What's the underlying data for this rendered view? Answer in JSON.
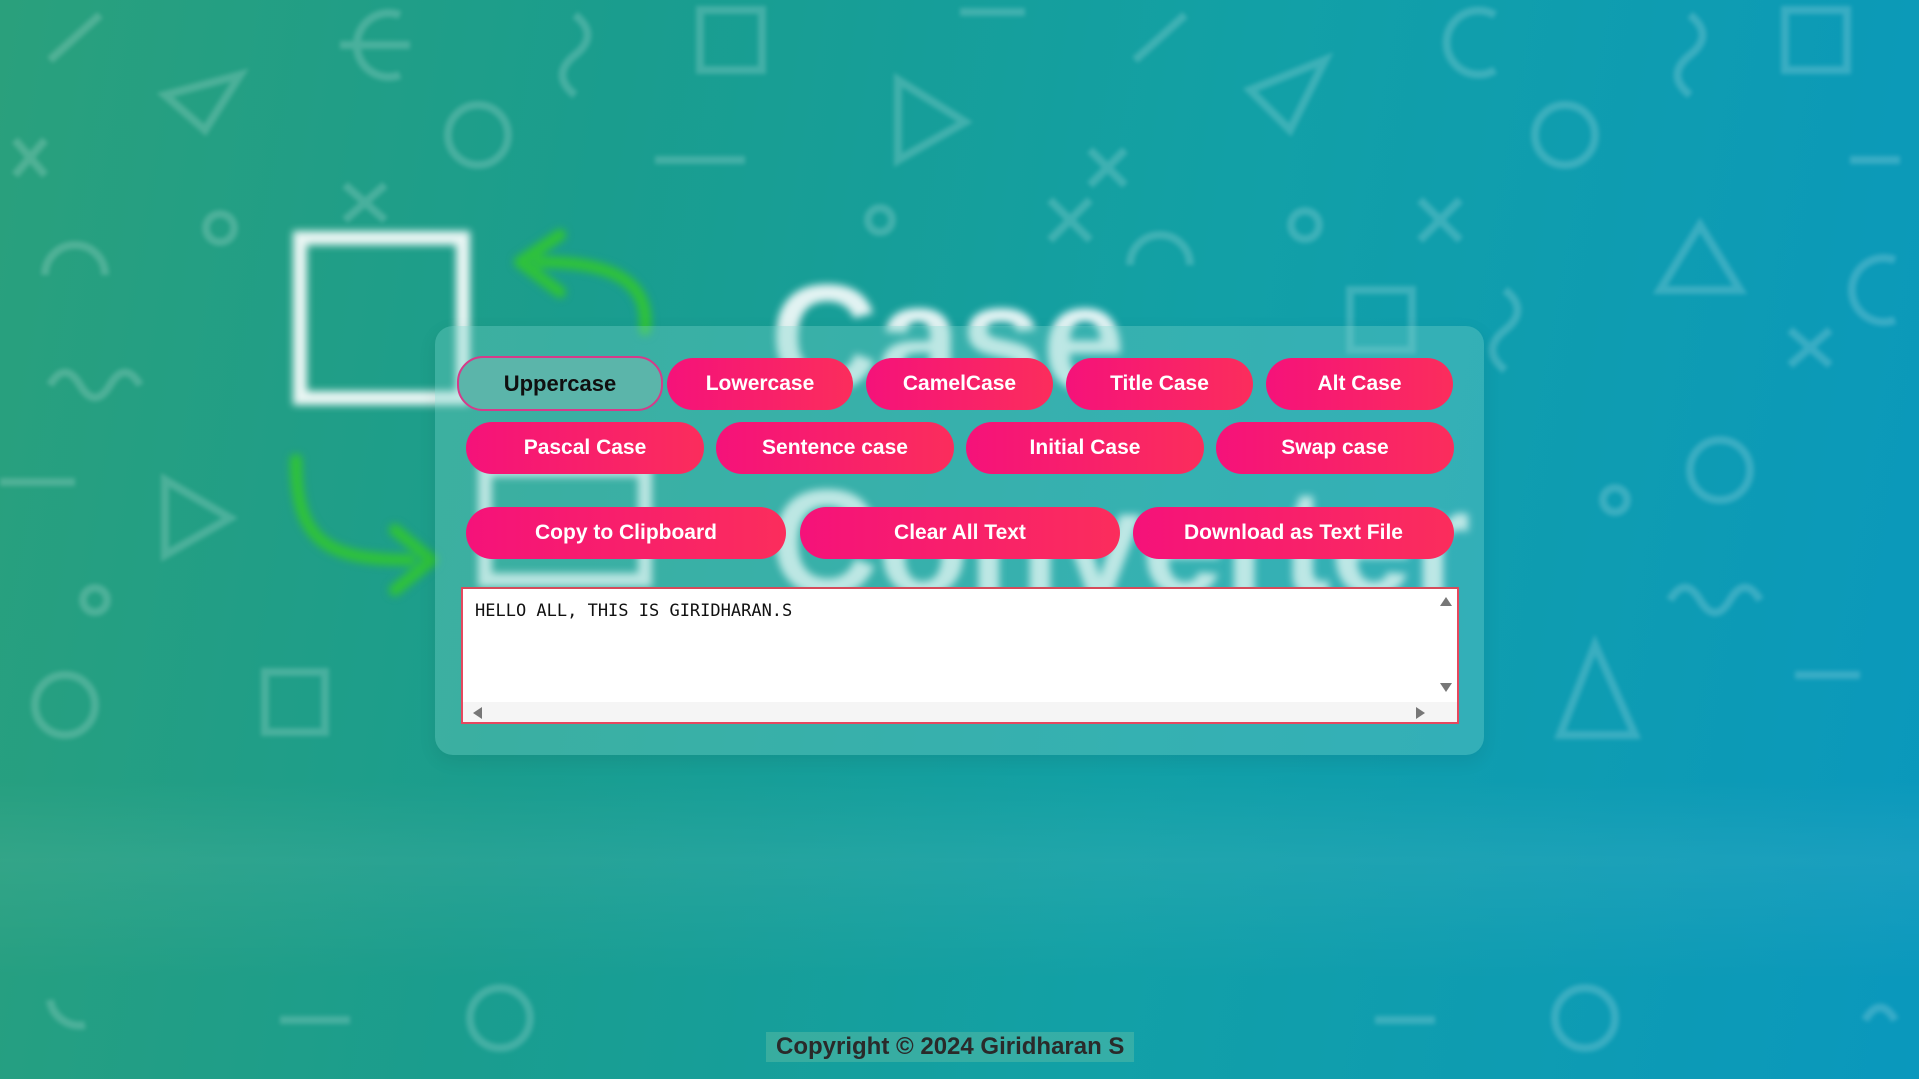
{
  "app": {
    "title_part1": "Case",
    "title_part2": "Converter"
  },
  "case_buttons": [
    {
      "label": "Uppercase",
      "active": true
    },
    {
      "label": "Lowercase"
    },
    {
      "label": "CamelCase"
    },
    {
      "label": "Title Case"
    },
    {
      "label": "Alt Case"
    },
    {
      "label": "Pascal Case"
    },
    {
      "label": "Sentence case"
    },
    {
      "label": "Initial Case"
    },
    {
      "label": "Swap case"
    }
  ],
  "actions": {
    "copy_label": "Copy to Clipboard",
    "clear_label": "Clear All Text",
    "download_label": "Download as Text File"
  },
  "editor": {
    "value": "HELLO ALL, THIS IS GIRIDHARAN.S"
  },
  "footer": {
    "text": "Copyright © 2024 Giridharan S"
  },
  "colors": {
    "button_gradient_start": "#f5127a",
    "button_gradient_end": "#fb2d5c",
    "active_button_bg": "#5bb5aa",
    "active_button_border": "#d63a8a",
    "logo_arrow": "#2fc23a"
  }
}
